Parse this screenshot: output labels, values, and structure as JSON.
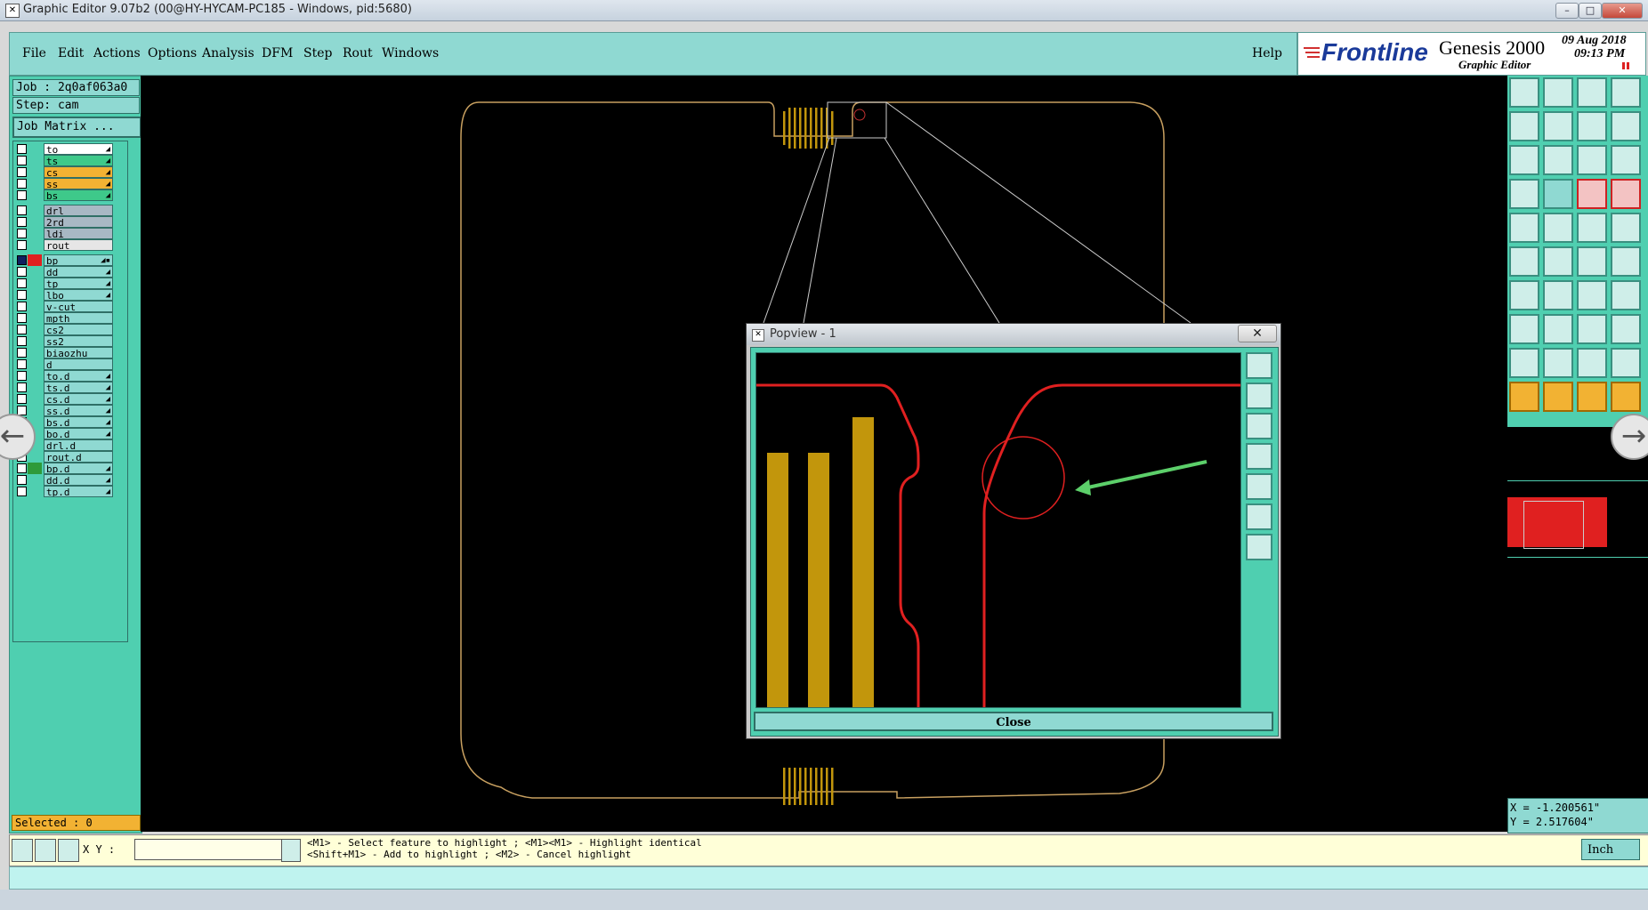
{
  "window": {
    "title": "Graphic Editor 9.07b2 (00@HY-HYCAM-PC185 - Windows, pid:5680)"
  },
  "menu": {
    "items": [
      "File",
      "Edit",
      "Actions",
      "Options",
      "Analysis",
      "DFM",
      "Step",
      "Rout",
      "Windows"
    ],
    "help": "Help"
  },
  "brand": {
    "logo": "Frontline",
    "product": "Genesis 2000",
    "subtitle": "Graphic Editor",
    "date": "09 Aug 2018",
    "time": "09:13 PM"
  },
  "job": {
    "job_label": "Job : 2q0af063a0",
    "step_label": "Step: cam",
    "matrix_button": "Job Matrix ..."
  },
  "layers": [
    {
      "name": "to",
      "color": "#ffffff",
      "group": 1,
      "ind": "◢"
    },
    {
      "name": "ts",
      "color": "#3ec98a",
      "group": 1,
      "ind": "◢"
    },
    {
      "name": "cs",
      "color": "#f2b233",
      "group": 1,
      "ind": "◢"
    },
    {
      "name": "ss",
      "color": "#f2b233",
      "group": 1,
      "ind": "◢"
    },
    {
      "name": "bs",
      "color": "#3ec98a",
      "group": 1,
      "ind": "◢"
    },
    {
      "name": "drl",
      "color": "#a8b8c4",
      "group": 2,
      "ind": ""
    },
    {
      "name": "2rd",
      "color": "#a8b8c4",
      "group": 2,
      "ind": ""
    },
    {
      "name": "ldi",
      "color": "#a8b8c4",
      "group": 2,
      "ind": ""
    },
    {
      "name": "rout",
      "color": "#e6e6e6",
      "group": 2,
      "ind": ""
    },
    {
      "name": "bp",
      "color": "#8fd9d2",
      "group": 3,
      "ind": "◢▪",
      "active": true
    },
    {
      "name": "dd",
      "color": "#8fd9d2",
      "group": 3,
      "ind": "◢"
    },
    {
      "name": "tp",
      "color": "#8fd9d2",
      "group": 3,
      "ind": "◢"
    },
    {
      "name": "lbo",
      "color": "#8fd9d2",
      "group": 3,
      "ind": "◢"
    },
    {
      "name": "v-cut",
      "color": "#8fd9d2",
      "group": 3,
      "ind": ""
    },
    {
      "name": "mpth",
      "color": "#8fd9d2",
      "group": 3,
      "ind": ""
    },
    {
      "name": "cs2",
      "color": "#8fd9d2",
      "group": 3,
      "ind": ""
    },
    {
      "name": "ss2",
      "color": "#8fd9d2",
      "group": 3,
      "ind": ""
    },
    {
      "name": "biaozhu",
      "color": "#8fd9d2",
      "group": 3,
      "ind": ""
    },
    {
      "name": "d",
      "color": "#8fd9d2",
      "group": 3,
      "ind": ""
    },
    {
      "name": "to.d",
      "color": "#8fd9d2",
      "group": 3,
      "ind": "◢"
    },
    {
      "name": "ts.d",
      "color": "#8fd9d2",
      "group": 3,
      "ind": "◢"
    },
    {
      "name": "cs.d",
      "color": "#8fd9d2",
      "group": 3,
      "ind": "◢"
    },
    {
      "name": "ss.d",
      "color": "#8fd9d2",
      "group": 3,
      "ind": "◢"
    },
    {
      "name": "bs.d",
      "color": "#8fd9d2",
      "group": 3,
      "ind": "◢"
    },
    {
      "name": "bo.d",
      "color": "#8fd9d2",
      "group": 3,
      "ind": "◢"
    },
    {
      "name": "drl.d",
      "color": "#8fd9d2",
      "group": 3,
      "ind": ""
    },
    {
      "name": "rout.d",
      "color": "#8fd9d2",
      "group": 3,
      "ind": ""
    },
    {
      "name": "bp.d",
      "color": "#8fd9d2",
      "group": 3,
      "ind": "◢",
      "swatch": "#2e9a3a"
    },
    {
      "name": "dd.d",
      "color": "#8fd9d2",
      "group": 3,
      "ind": "◢"
    },
    {
      "name": "tp.d",
      "color": "#8fd9d2",
      "group": 3,
      "ind": "◢"
    }
  ],
  "selection": {
    "label": "Selected : 0"
  },
  "popup": {
    "title": "Popview - 1",
    "close_label": "Close"
  },
  "coords": {
    "x": "X = -1.200561\"",
    "y": "Y = 2.517604\""
  },
  "status": {
    "xy_label": "X Y :",
    "xy_value": "",
    "hint_line1": "<M1> - Select feature to highlight ; <M1><M1> - Highlight identical",
    "hint_line2": "<Shift+M1> - Add to highlight ; <M2> - Cancel highlight",
    "units": "Inch"
  },
  "colors": {
    "canvas_bg": "#000000",
    "panel_teal": "#4fcfb0",
    "menu_teal": "#8fd9d2",
    "profile_outline": "#c8a060",
    "pad_gold": "#c2960c",
    "trace_red": "#e02020",
    "arrow_green": "#5ccf6a"
  }
}
